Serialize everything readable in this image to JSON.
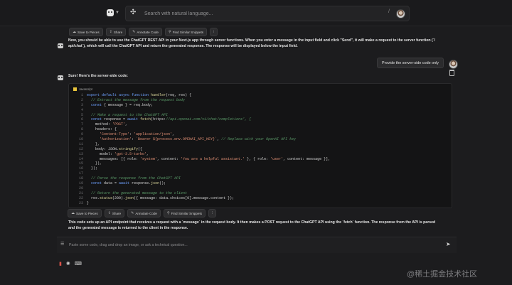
{
  "topbar": {
    "search_placeholder": "Search with natural language...",
    "slash_hint": "/"
  },
  "actions_top": {
    "save": "Save to Pieces",
    "share": "Share",
    "annotate": "Annotate Code",
    "similar": "Find Similar Snippets",
    "more": "⋮"
  },
  "message1": {
    "text_line1": "Now, you should be able to use the ChatGPT REST API in your Next.js app through server functions. When you enter a message in the input field and click \"Send\", it will make a request to the server function (`/",
    "text_line2": "api/chat`), which will call the ChatGPT API and return the generated response. The response will be displayed below the input field."
  },
  "user_message": "Provide the server-side code only",
  "message2": {
    "intro": "Sure! Here's the server-side code:",
    "language": "Javascript",
    "code": [
      "export default async function handler(req, res) {",
      "  // Extract the message from the request body",
      "  const { message } = req.body;",
      "",
      "  // Make a request to the ChatGPT API",
      "  const response = await fetch('https://api.openai.com/v1/chat/completions', {",
      "    method: 'POST',",
      "    headers: {",
      "      'Content-Type': 'application/json',",
      "      'Authorization': `Bearer ${process.env.OPENAI_API_KEY}`, // Replace with your OpenAI API key",
      "    },",
      "    body: JSON.stringify({",
      "      model: 'gpt-3.5-turbo',",
      "      messages: [{ role: 'system', content: 'You are a helpful assistant.' }, { role: 'user', content: message }],",
      "    }),",
      "  });",
      "",
      "  // Parse the response from the ChatGPT API",
      "  const data = await response.json();",
      "",
      "  // Return the generated message to the client",
      "  res.status(200).json({ message: data.choices[0].message.content });",
      "}"
    ],
    "line_numbers": [
      "1",
      "2",
      "3",
      "4",
      "5",
      "6",
      "7",
      "8",
      "9",
      "10",
      "11",
      "12",
      "13",
      "14",
      "15",
      "16",
      "17",
      "18",
      "19",
      "20",
      "21",
      "22",
      "23"
    ],
    "outro_line1": "This code sets up an API endpoint that receives a request with a `message` in the request body. It then makes a POST request to the ChatGPT API using the `fetch` function. The response from the API is parsed",
    "outro_line2": "and the generated message is returned to the client in the response."
  },
  "actions_bottom": {
    "save": "Save to Pieces",
    "share": "Share",
    "annotate": "Annotate Code",
    "similar": "Find Similar Snippets",
    "more": "⋮"
  },
  "composer": {
    "placeholder": "Paste some code, drag and drop an image, or ask a technical question..."
  },
  "watermark": "@稀土掘金技术社区",
  "colors": {
    "background": "#1c1c1e",
    "code_bg": "#141415",
    "keyword": "#6ea1ff",
    "comment": "#5a9a68",
    "string": "#e08f74",
    "bottom_red_icon": "#d9524a"
  },
  "icons": [
    "logo-icon",
    "magic-search-icon",
    "cloud-save-icon",
    "share-icon",
    "annotate-icon",
    "search-similar-icon",
    "more-icon",
    "trash-icon",
    "javascript-icon",
    "chat-input-icon",
    "send-icon",
    "delete-icon",
    "copilot-icon",
    "chat-icon"
  ]
}
